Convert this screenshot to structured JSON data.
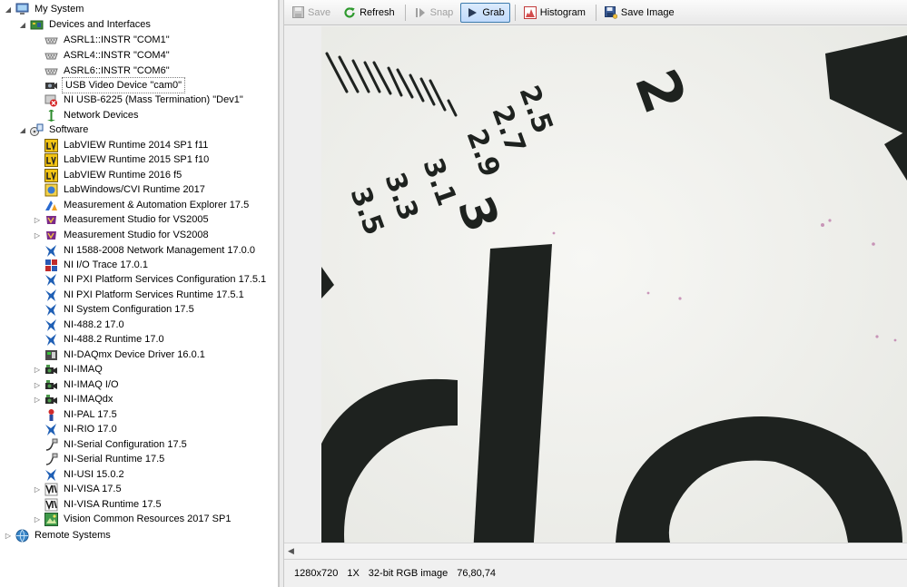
{
  "tree": {
    "items": [
      {
        "label": "My System",
        "icon": "computer-icon",
        "expander": "expanded"
      },
      {
        "label": "Devices and Interfaces",
        "icon": "devices-icon",
        "expander": "expanded"
      },
      {
        "label": "ASRL1::INSTR \"COM1\"",
        "icon": "serial-port-icon",
        "expander": "none"
      },
      {
        "label": "ASRL4::INSTR \"COM4\"",
        "icon": "serial-port-icon",
        "expander": "none"
      },
      {
        "label": "ASRL6::INSTR \"COM6\"",
        "icon": "serial-port-icon",
        "expander": "none"
      },
      {
        "label": "USB Video Device  \"cam0\"",
        "icon": "camera-icon",
        "expander": "none",
        "selected": true
      },
      {
        "label": "NI USB-6225 (Mass Termination) \"Dev1\"",
        "icon": "daq-device-error-icon",
        "expander": "none"
      },
      {
        "label": "Network Devices",
        "icon": "network-icon",
        "expander": "none"
      },
      {
        "label": "Software",
        "icon": "software-icon",
        "expander": "expanded"
      },
      {
        "label": "LabVIEW Runtime 2014 SP1 f11",
        "icon": "labview-icon",
        "expander": "none"
      },
      {
        "label": "LabVIEW Runtime 2015 SP1 f10",
        "icon": "labview-icon",
        "expander": "none"
      },
      {
        "label": "LabVIEW Runtime 2016 f5",
        "icon": "labview-icon",
        "expander": "none"
      },
      {
        "label": "LabWindows/CVI Runtime 2017",
        "icon": "labwindows-icon",
        "expander": "none"
      },
      {
        "label": "Measurement & Automation Explorer 17.5",
        "icon": "max-icon",
        "expander": "none"
      },
      {
        "label": "Measurement Studio for VS2005",
        "icon": "measurement-studio-icon",
        "expander": "collapsed"
      },
      {
        "label": "Measurement Studio for VS2008",
        "icon": "measurement-studio-icon",
        "expander": "collapsed"
      },
      {
        "label": "NI 1588-2008 Network Management 17.0.0",
        "icon": "ni-eagle-icon",
        "expander": "none"
      },
      {
        "label": "NI I/O Trace 17.0.1",
        "icon": "io-trace-icon",
        "expander": "none"
      },
      {
        "label": "NI PXI Platform Services Configuration 17.5.1",
        "icon": "ni-eagle-icon",
        "expander": "none"
      },
      {
        "label": "NI PXI Platform Services Runtime 17.5.1",
        "icon": "ni-eagle-icon",
        "expander": "none"
      },
      {
        "label": "NI System Configuration 17.5",
        "icon": "ni-eagle-icon",
        "expander": "none"
      },
      {
        "label": "NI-488.2 17.0",
        "icon": "ni-eagle-icon",
        "expander": "none"
      },
      {
        "label": "NI-488.2 Runtime 17.0",
        "icon": "ni-eagle-icon",
        "expander": "none"
      },
      {
        "label": "NI-DAQmx Device Driver 16.0.1",
        "icon": "daqmx-icon",
        "expander": "none"
      },
      {
        "label": "NI-IMAQ",
        "icon": "imaq-camera-icon",
        "expander": "collapsed"
      },
      {
        "label": "NI-IMAQ I/O",
        "icon": "imaq-camera-icon",
        "expander": "collapsed"
      },
      {
        "label": "NI-IMAQdx",
        "icon": "imaq-camera-icon",
        "expander": "collapsed"
      },
      {
        "label": "NI-PAL 17.5",
        "icon": "ni-pal-icon",
        "expander": "none"
      },
      {
        "label": "NI-RIO 17.0",
        "icon": "ni-eagle-icon",
        "expander": "none"
      },
      {
        "label": "NI-Serial Configuration 17.5",
        "icon": "serial-cable-icon",
        "expander": "none"
      },
      {
        "label": "NI-Serial Runtime 17.5",
        "icon": "serial-cable-icon",
        "expander": "none"
      },
      {
        "label": "NI-USI 15.0.2",
        "icon": "ni-eagle-icon",
        "expander": "none"
      },
      {
        "label": "NI-VISA 17.5",
        "icon": "visa-icon",
        "expander": "collapsed"
      },
      {
        "label": "NI-VISA Runtime 17.5",
        "icon": "visa-icon",
        "expander": "none"
      },
      {
        "label": "Vision Common Resources 2017 SP1",
        "icon": "vision-icon",
        "expander": "collapsed"
      },
      {
        "label": "Remote Systems",
        "icon": "remote-systems-icon",
        "expander": "collapsed"
      }
    ]
  },
  "toolbar": {
    "save_label": "Save",
    "refresh_label": "Refresh",
    "snap_label": "Snap",
    "grab_label": "Grab",
    "histogram_label": "Histogram",
    "save_image_label": "Save Image"
  },
  "status": {
    "resolution": "1280x720",
    "zoom": "1X",
    "image_type": "32-bit RGB image",
    "pixel_value": "76,80,74"
  },
  "image": {
    "scale_numbers": [
      "2.5",
      "2.7",
      "2.9",
      "3.1",
      "3.3",
      "3.5",
      "3"
    ],
    "large_digit": "2"
  },
  "colors": {
    "selection_border": "#7a7a7a",
    "active_button": "#c1dbfc",
    "ink": "#1e221f"
  }
}
